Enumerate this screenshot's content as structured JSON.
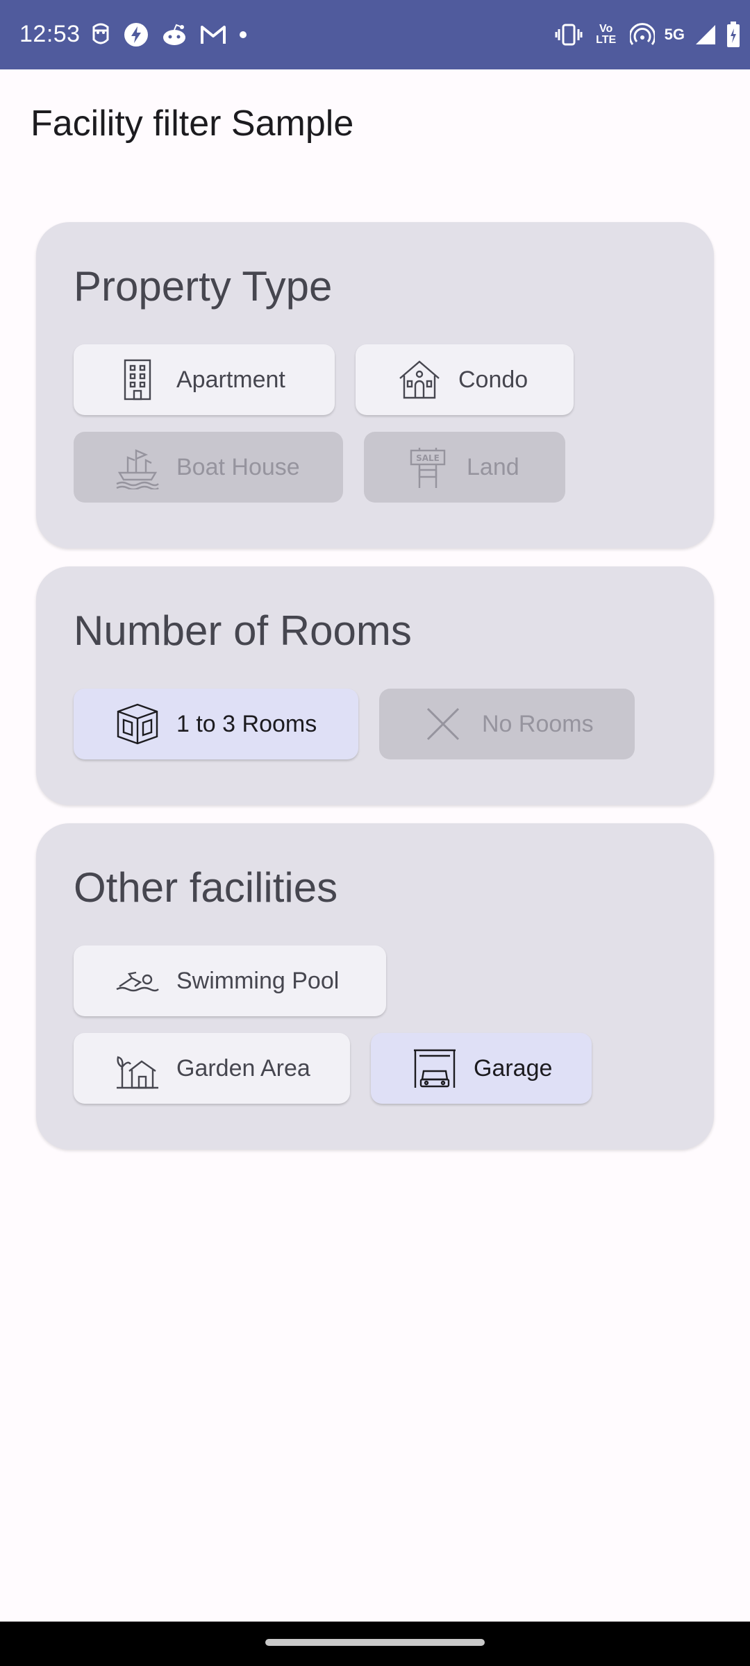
{
  "status_bar": {
    "time": "12:53",
    "left_icons": [
      "face-icon",
      "bolt-circle-icon",
      "reddit-icon",
      "gmail-icon",
      "dot-icon"
    ],
    "right_icons": [
      "vibrate-icon",
      "volte-icon",
      "hotspot-icon",
      "5g-icon",
      "signal-icon",
      "battery-charging-icon"
    ],
    "volte_label": "Vo\nLTE",
    "network_label": "5G"
  },
  "app": {
    "title": "Facility filter Sample"
  },
  "sections": {
    "property_type": {
      "title": "Property Type",
      "chips": [
        {
          "label": "Apartment",
          "icon": "apartment-building-icon",
          "state": "enabled"
        },
        {
          "label": "Condo",
          "icon": "condo-house-icon",
          "state": "enabled"
        },
        {
          "label": "Boat House",
          "icon": "boat-icon",
          "state": "disabled"
        },
        {
          "label": "Land",
          "icon": "sale-sign-icon",
          "state": "disabled"
        }
      ]
    },
    "rooms": {
      "title": "Number of Rooms",
      "chips": [
        {
          "label": "1 to 3 Rooms",
          "icon": "room-cube-icon",
          "state": "selected"
        },
        {
          "label": "No Rooms",
          "icon": "close-icon",
          "state": "disabled"
        }
      ]
    },
    "facilities": {
      "title": "Other facilities",
      "chips": [
        {
          "label": "Swimming Pool",
          "icon": "swimmer-icon",
          "state": "enabled"
        },
        {
          "label": "Garden Area",
          "icon": "garden-house-icon",
          "state": "enabled"
        },
        {
          "label": "Garage",
          "icon": "garage-car-icon",
          "state": "selected"
        }
      ]
    }
  },
  "colors": {
    "status_bar": "#505b9d",
    "card_bg": "#e2e0e8",
    "chip_bg": "#f2f1f6",
    "chip_selected_bg": "#dfe0f6",
    "chip_disabled_bg": "#c8c6ce"
  }
}
